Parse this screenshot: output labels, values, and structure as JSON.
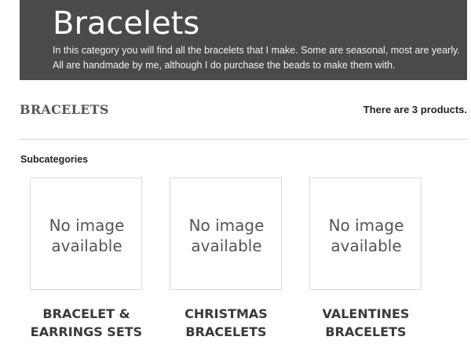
{
  "category": {
    "title": "Bracelets",
    "description": "In this category you will find all the bracelets that I make.  Some are seasonal, most are yearly.  All are handmade by me, although I do purchase the beads to make them with.",
    "heading": "BRACELETS",
    "product_count_text": "There are 3 products."
  },
  "subcategories": {
    "label": "Subcategories",
    "items": [
      {
        "image_text": "No image\navailable",
        "name": "BRACELET &\nEARRINGS SETS"
      },
      {
        "image_text": "No image\navailable",
        "name": "CHRISTMAS\nBRACELETS"
      },
      {
        "image_text": "No image\navailable",
        "name": "VALENTINES\nBRACELETS"
      }
    ]
  },
  "colors": {
    "banner_background": "#4a4a4a",
    "banner_text": "#ffffff",
    "heading_text": "#555555",
    "divider": "#d6d6d6",
    "thumbnail_border": "#d9d9d9"
  }
}
